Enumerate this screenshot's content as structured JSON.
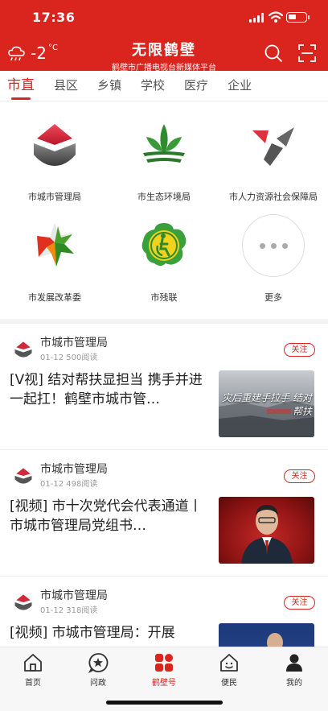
{
  "status_bar": {
    "time": "17:36"
  },
  "header": {
    "weather_icon": "cloud-icon",
    "temperature": "-2",
    "temperature_unit": "°C",
    "title": "无限鹤壁",
    "subtitle": "鹤壁市广播电视台新媒体平台",
    "search_icon": "search-icon",
    "scan_icon": "scan-icon",
    "bg_color": "#d9251d"
  },
  "tabs": [
    {
      "label": "市直",
      "active": true
    },
    {
      "label": "县区"
    },
    {
      "label": "乡镇"
    },
    {
      "label": "学校"
    },
    {
      "label": "医疗"
    },
    {
      "label": "企业"
    }
  ],
  "grid": [
    {
      "label": "市城市管理局",
      "icon": "city-management-logo"
    },
    {
      "label": "市生态环境局",
      "icon": "ecology-environment-logo"
    },
    {
      "label": "市人力资源社会保障局",
      "icon": "human-resources-logo"
    },
    {
      "label": "市发展改革委",
      "icon": "development-reform-logo"
    },
    {
      "label": "市残联",
      "icon": "disabled-federation-logo"
    },
    {
      "label": "更多",
      "icon": "more-icon"
    }
  ],
  "feed": [
    {
      "source": "市城市管理局",
      "date": "01-12",
      "reads": "500阅读",
      "follow": "关注",
      "headline": "[V视] 结对帮扶显担当 携手并进一起扛！鹤壁市城市管…",
      "thumb_text": "灾后重建手拉手 结对帮扶"
    },
    {
      "source": "市城市管理局",
      "date": "01-12",
      "reads": "498阅读",
      "follow": "关注",
      "headline": "[视频] 市十次党代会代表通道丨市城市管理局党组书…"
    },
    {
      "source": "市城市管理局",
      "date": "01-12",
      "reads": "318阅读",
      "follow": "关注",
      "headline": "[视频] 市城市管理局：开展"
    }
  ],
  "bottom_nav": [
    {
      "label": "首页",
      "icon": "home-icon"
    },
    {
      "label": "问政",
      "icon": "star-chat-icon"
    },
    {
      "label": "鹤壁号",
      "icon": "apps-icon",
      "active": true
    },
    {
      "label": "便民",
      "icon": "smile-house-icon"
    },
    {
      "label": "我的",
      "icon": "user-icon"
    }
  ]
}
